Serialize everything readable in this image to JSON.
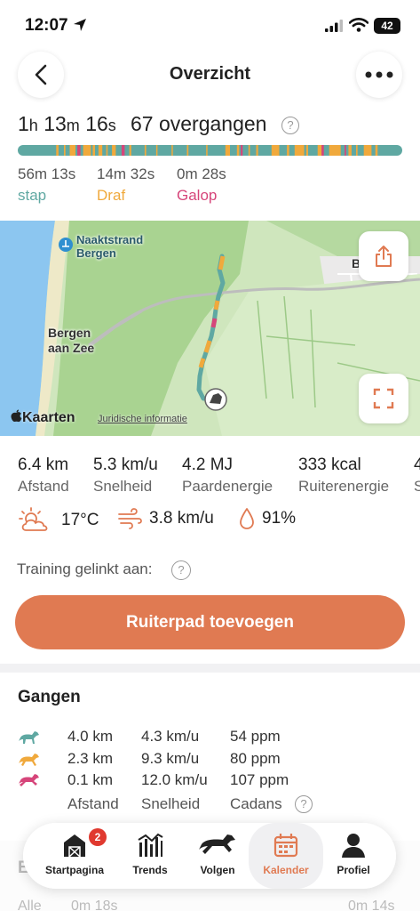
{
  "status_bar": {
    "time": "12:07",
    "battery": "42"
  },
  "header": {
    "title": "Overzicht",
    "back_icon": "chevron-left-icon",
    "more_icon": "ellipsis-icon"
  },
  "summary": {
    "duration": {
      "h": "1",
      "h_unit": "h",
      "m": "13",
      "m_unit": "m",
      "s": "16",
      "s_unit": "s"
    },
    "transitions": "67 overgangen",
    "help_symbol": "?"
  },
  "gaits": [
    {
      "time": "56m 13s",
      "label": "stap",
      "color": "#5fa8a2"
    },
    {
      "time": "14m 32s",
      "label": "Draf",
      "color": "#f0a93c"
    },
    {
      "time": "0m 28s",
      "label": "Galop",
      "color": "#d6457a"
    }
  ],
  "map": {
    "labels": {
      "beach": "Naaktstrand Bergen",
      "beach_line1": "Naaktstrand",
      "beach_line2": "Bergen",
      "town_line1": "Bergen",
      "town_line2": "aan Zee",
      "partial": "B"
    },
    "brand": "Kaarten",
    "legal": "Juridische informatie",
    "share_icon": "share-icon",
    "expand_icon": "expand-icon"
  },
  "metrics": [
    {
      "value": "6.4 km",
      "label": "Afstand"
    },
    {
      "value": "5.3 km/u",
      "label": "Snelheid"
    },
    {
      "value": "4.2 MJ",
      "label": "Paardenergie"
    },
    {
      "value": "333 kcal",
      "label": "Ruiterenergie"
    },
    {
      "value": "4",
      "label": "S"
    }
  ],
  "weather": {
    "temperature": "17°C",
    "wind": "3.8 km/u",
    "humidity": "91%"
  },
  "linked": {
    "label": "Training gelinkt aan:"
  },
  "primary_button": "Ruiterpad toevoegen",
  "gangen": {
    "title": "Gangen",
    "rows": [
      {
        "distance": "4.0 km",
        "speed": "4.3 km/u",
        "cadence": "54 ppm",
        "color": "#5fa8a2"
      },
      {
        "distance": "2.3 km",
        "speed": "9.3 km/u",
        "cadence": "80 ppm",
        "color": "#f0a93c"
      },
      {
        "distance": "0.1 km",
        "speed": "12.0 km/u",
        "cadence": "107 ppm",
        "color": "#d6457a"
      }
    ],
    "footer": {
      "distance": "Afstand",
      "speed": "Snelheid",
      "cadence": "Cadans"
    }
  },
  "peek": {
    "letter": "E",
    "row_label": "Alle",
    "row_val1": "0m 18s",
    "row_val2": "0m 14s"
  },
  "tabbar": {
    "badge": "2",
    "tabs": [
      {
        "label": "Startpagina",
        "icon": "barn-icon"
      },
      {
        "label": "Trends",
        "icon": "trends-icon"
      },
      {
        "label": "Volgen",
        "icon": "horse-icon"
      },
      {
        "label": "Kalender",
        "icon": "calendar-icon"
      },
      {
        "label": "Profiel",
        "icon": "person-icon"
      }
    ]
  },
  "colors": {
    "accent": "#e07a52",
    "walk": "#5fa8a2",
    "trot": "#f0a93c",
    "canter": "#d6457a",
    "badge": "#e0392f"
  }
}
